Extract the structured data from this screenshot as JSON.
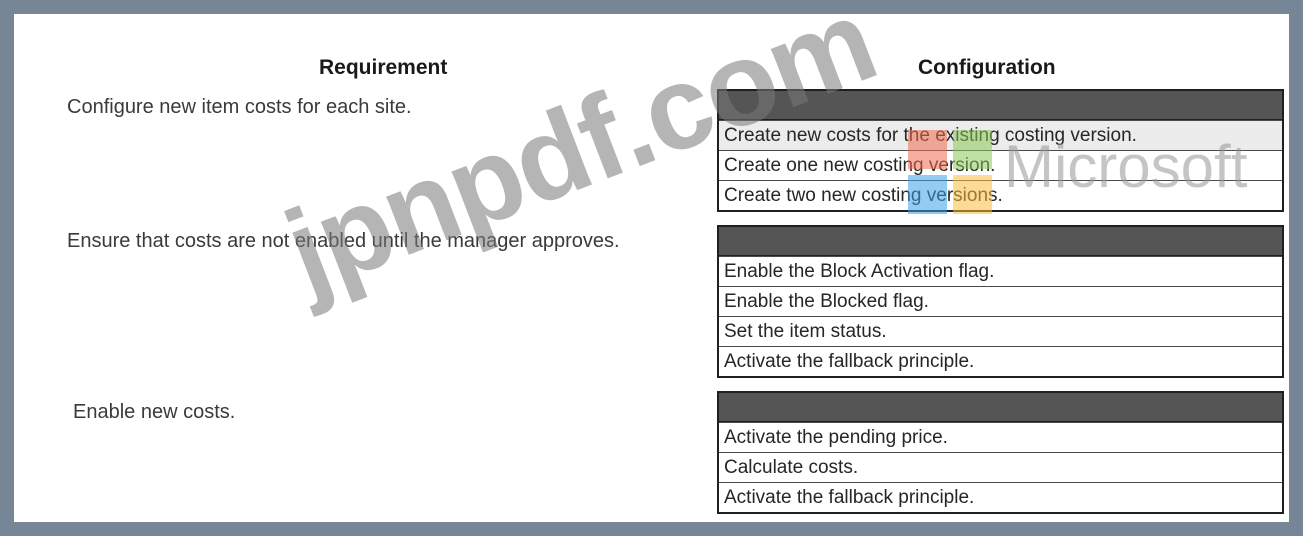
{
  "headers": {
    "requirement": "Requirement",
    "configuration": "Configuration"
  },
  "rows": [
    {
      "requirement": "Configure new item costs for each site.",
      "options": [
        "Create new costs for the existing costing version.",
        "Create one new costing version.",
        "Create two new costing versions."
      ]
    },
    {
      "requirement": "Ensure that costs are not enabled until the manager approves.",
      "options": [
        "Enable the Block Activation flag.",
        "Enable the Blocked flag.",
        "Set the item status.",
        "Activate the fallback principle."
      ]
    },
    {
      "requirement": "Enable new costs.",
      "options": [
        "Activate the pending price.",
        "Calculate costs.",
        "Activate the fallback principle."
      ]
    }
  ],
  "watermark": {
    "text": "jpnpdf.com",
    "logo_name": "Microsoft",
    "logo_colors": [
      "#ee6e50",
      "#8cc85a",
      "#3ca0e6",
      "#fabe3c"
    ]
  }
}
